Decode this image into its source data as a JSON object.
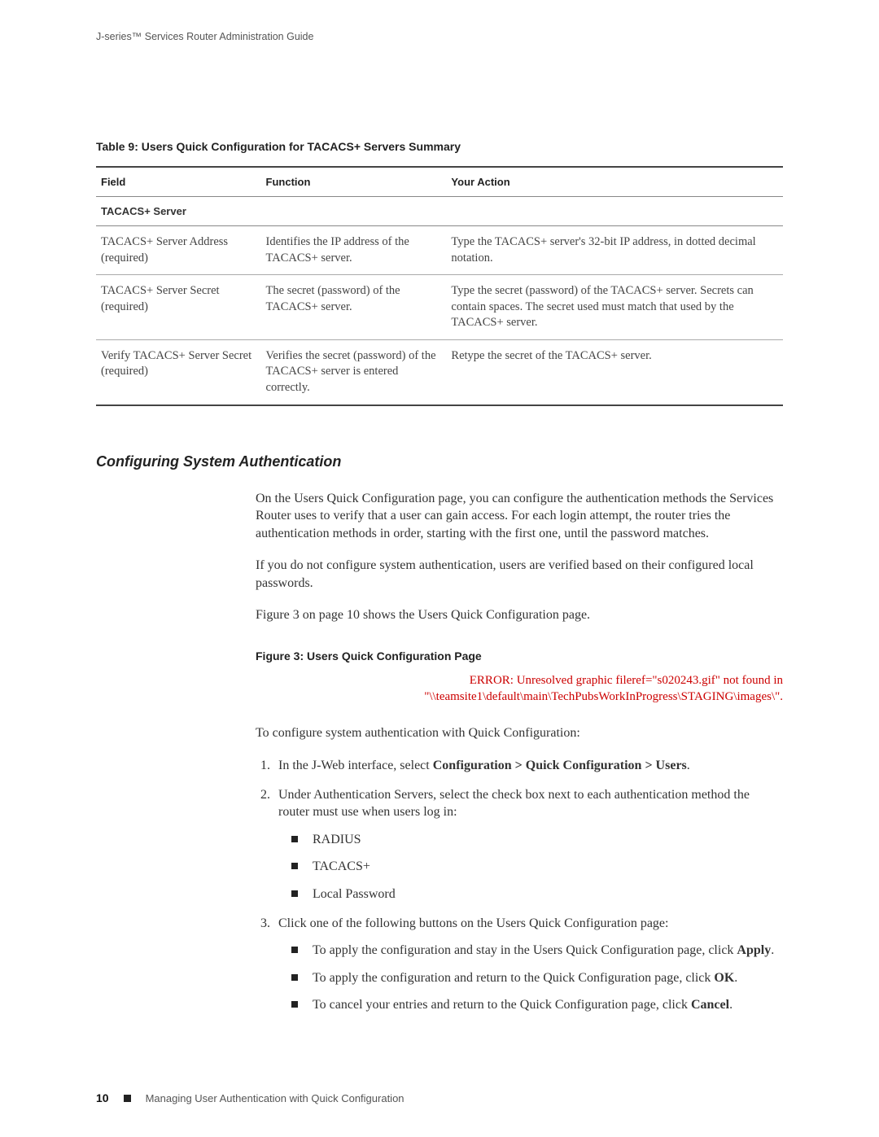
{
  "runningHead": "J-series™ Services Router Administration Guide",
  "tableCaption": "Table 9: Users Quick Configuration for TACACS+ Servers Summary",
  "tableHeaders": {
    "field": "Field",
    "function": "Function",
    "action": "Your Action"
  },
  "sectionRowLabel": "TACACS+ Server",
  "rows": [
    {
      "field": "TACACS+ Server Address (required)",
      "function": "Identifies the IP address of the TACACS+ server.",
      "action": "Type the TACACS+ server's 32-bit IP address, in dotted decimal notation."
    },
    {
      "field": "TACACS+ Server Secret (required)",
      "function": "The secret (password) of the TACACS+ server.",
      "action": "Type the secret (password) of the TACACS+ server. Secrets can contain spaces. The secret used must match that used by the TACACS+ server."
    },
    {
      "field": "Verify TACACS+ Server Secret (required)",
      "function": "Verifies the secret (password) of the TACACS+ server is entered correctly.",
      "action": "Retype the secret of the TACACS+ server."
    }
  ],
  "sectionHeading": "Configuring System Authentication",
  "para1": "On the Users Quick Configuration page, you can configure the authentication methods the Services Router uses to verify that a user can gain access. For each login attempt, the router tries the authentication methods in order, starting with the first one, until the password matches.",
  "para2": "If you do not configure system authentication, users are verified based on their configured local passwords.",
  "para3": "Figure 3 on page 10 shows the Users Quick Configuration page.",
  "figureCaption": "Figure 3: Users Quick Configuration Page",
  "errorLine1": "ERROR: Unresolved graphic fileref=\"s020243.gif\" not found in",
  "errorLine2": "\"\\\\teamsite1\\default\\main\\TechPubsWorkInProgress\\STAGING\\images\\\".",
  "introLine": "To configure system authentication with Quick Configuration:",
  "step1_pre": "In the J-Web interface, select ",
  "step1_bold": "Configuration > Quick Configuration > Users",
  "step1_post": ".",
  "step2": "Under Authentication Servers, select the check box next to each authentication method the router must use when users log in:",
  "methods": [
    "RADIUS",
    "TACACS+",
    "Local Password"
  ],
  "step3": "Click one of the following buttons on the Users Quick Configuration page:",
  "btn1_pre": "To apply the configuration and stay in the Users Quick Configuration page, click ",
  "btn1_bold": "Apply",
  "btn1_post": ".",
  "btn2_pre": "To apply the configuration and return to the Quick Configuration page, click ",
  "btn2_bold": "OK",
  "btn2_post": ".",
  "btn3_pre": "To cancel your entries and return to the Quick Configuration page, click ",
  "btn3_bold": "Cancel",
  "btn3_post": ".",
  "footer": {
    "pageNum": "10",
    "section": "Managing User Authentication with Quick Configuration"
  }
}
